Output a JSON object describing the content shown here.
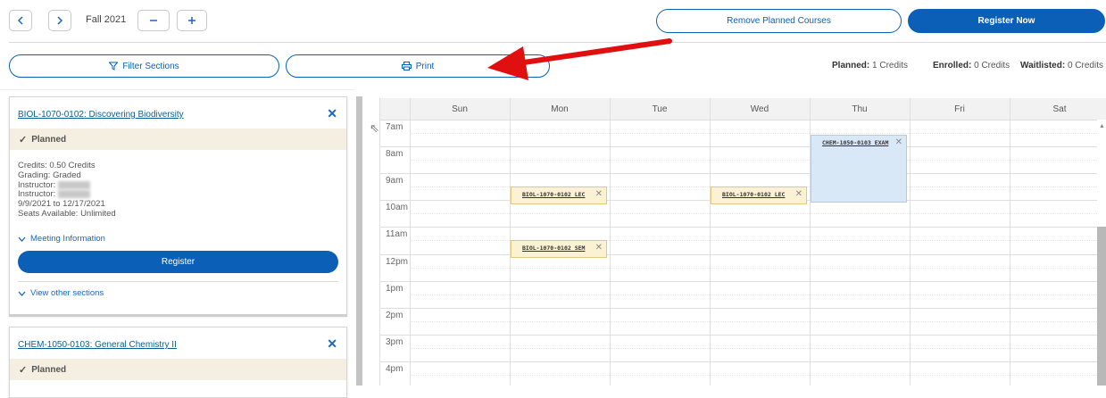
{
  "term": {
    "label": "Fall 2021"
  },
  "header": {
    "remove_planned": "Remove Planned Courses",
    "register_now": "Register Now"
  },
  "toolbar": {
    "filter_sections": "Filter Sections",
    "print": "Print"
  },
  "credits": {
    "planned_label": "Planned:",
    "planned_value": "1 Credits",
    "enrolled_label": "Enrolled:",
    "enrolled_value": "0 Credits",
    "waitlisted_label": "Waitlisted:",
    "waitlisted_value": "0 Credits"
  },
  "cards": [
    {
      "title": "BIOL-1070-0102: Discovering Biodiversity",
      "status": "Planned",
      "credits": "Credits: 0.50 Credits",
      "grading": "Grading: Graded",
      "instructor1": "Instructor:",
      "instructor2": "Instructor:",
      "dates": "9/9/2021 to 12/17/2021",
      "seats": "Seats Available:  Unlimited",
      "meeting_info": "Meeting Information",
      "register": "Register",
      "view_other": "View other sections"
    },
    {
      "title": "CHEM-1050-0103: General Chemistry II",
      "status": "Planned"
    }
  ],
  "calendar": {
    "days": [
      "Sun",
      "Mon",
      "Tue",
      "Wed",
      "Thu",
      "Fri",
      "Sat"
    ],
    "times": [
      "7am",
      "8am",
      "9am",
      "10am",
      "11am",
      "12pm",
      "1pm",
      "2pm",
      "3pm",
      "4pm"
    ],
    "events": [
      {
        "label": "BIOL-1070-0102 LEC",
        "day": "Mon",
        "start": "9am",
        "end": "10am",
        "color": "#fbf1d3"
      },
      {
        "label": "BIOL-1070-0102 LEC",
        "day": "Wed",
        "start": "9am",
        "end": "10am",
        "color": "#fbf1d3"
      },
      {
        "label": "CHEM-1050-0103 EXAM",
        "day": "Thu",
        "start": "8am",
        "end": "10am",
        "color": "#d9e8f6"
      },
      {
        "label": "BIOL-1070-0102 SEM",
        "day": "Mon",
        "start": "11am",
        "end": "12pm",
        "color": "#fbf1d3"
      }
    ]
  },
  "colors": {
    "accent": "#0b5fb7",
    "annotation_arrow": "#e01010"
  }
}
